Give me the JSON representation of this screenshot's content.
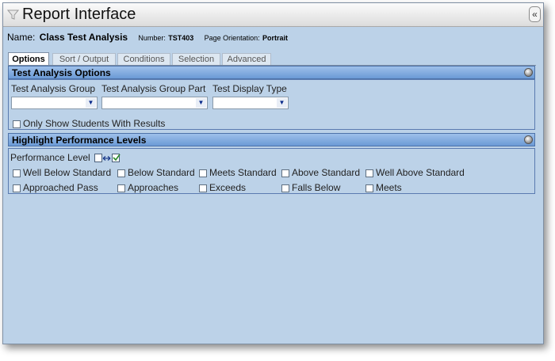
{
  "window": {
    "title": "Report Interface",
    "collapse_label": "«"
  },
  "report": {
    "name_label": "Name:",
    "name_value": "Class Test Analysis",
    "number_label": "Number:",
    "number_value": "TST403",
    "orientation_label": "Page Orientation:",
    "orientation_value": "Portrait"
  },
  "tabs": [
    {
      "label": "Options",
      "active": true
    },
    {
      "label": "Sort / Output",
      "active": false
    },
    {
      "label": "Conditions",
      "active": false
    },
    {
      "label": "Selection",
      "active": false
    },
    {
      "label": "Advanced",
      "active": false
    }
  ],
  "test_analysis_options": {
    "title": "Test Analysis Options",
    "fields": [
      {
        "label": "Test Analysis Group",
        "value": ""
      },
      {
        "label": "Test Analysis Group Part",
        "value": ""
      },
      {
        "label": "Test Display Type",
        "value": ""
      }
    ],
    "only_show_label": "Only Show Students With Results",
    "only_show_checked": false
  },
  "highlight_performance_levels": {
    "title": "Highlight Performance Levels",
    "performance_level_label": "Performance Level",
    "levels": [
      {
        "label": "Well Below Standard",
        "checked": false
      },
      {
        "label": "Below Standard",
        "checked": false
      },
      {
        "label": "Meets Standard",
        "checked": false
      },
      {
        "label": "Above Standard",
        "checked": false
      },
      {
        "label": "Well Above Standard",
        "checked": false
      },
      {
        "label": "Approached Pass",
        "checked": false
      },
      {
        "label": "Approaches",
        "checked": false
      },
      {
        "label": "Exceeds",
        "checked": false
      },
      {
        "label": "Falls Below",
        "checked": false
      },
      {
        "label": "Meets",
        "checked": false
      }
    ]
  },
  "colors": {
    "window_bg": "#bcd2e8",
    "section_header": "#7fa8de",
    "active_tab": "#ffffff"
  }
}
